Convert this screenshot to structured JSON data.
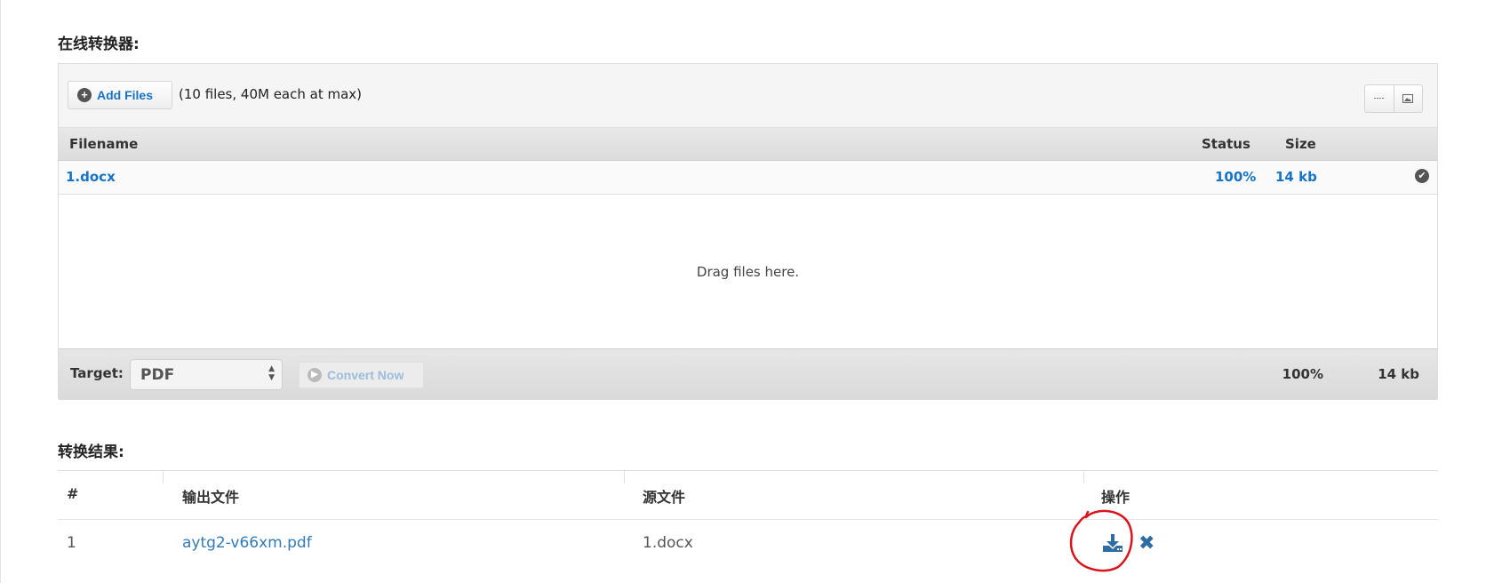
{
  "converter": {
    "title": "在线转换器:",
    "add_files_label": "Add Files",
    "limit_text": "(10 files, 40M each at max)",
    "columns": {
      "filename": "Filename",
      "status": "Status",
      "size": "Size"
    },
    "files": [
      {
        "name": "1.docx",
        "status": "100%",
        "size": "14 kb"
      }
    ],
    "drop_hint": "Drag files here.",
    "target_label": "Target:",
    "target_value": "PDF",
    "convert_label": "Convert Now",
    "total_status": "100%",
    "total_size": "14 kb"
  },
  "results": {
    "title": "转换结果:",
    "columns": {
      "index": "#",
      "output": "输出文件",
      "source": "源文件",
      "actions": "操作"
    },
    "rows": [
      {
        "index": "1",
        "output": "aytg2-v66xm.pdf",
        "source": "1.docx"
      }
    ]
  },
  "icons": {
    "add": "plus-circle-icon",
    "list_view": "list-view-icon",
    "thumb_view": "thumbnail-view-icon",
    "done": "check-circle-icon",
    "select": "up-down-arrows-icon",
    "convert": "arrow-circle-icon",
    "download": "download-icon",
    "delete": "close-icon"
  },
  "colors": {
    "link": "#1673c5",
    "result_link": "#337ab7",
    "annotation": "#d8141c"
  }
}
